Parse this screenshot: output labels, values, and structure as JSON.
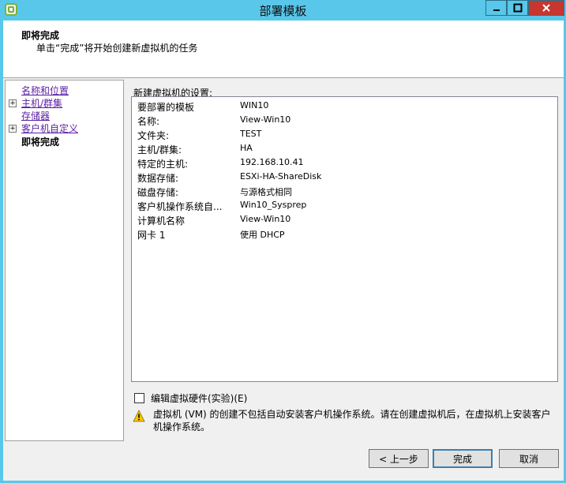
{
  "window": {
    "title": "部署模板"
  },
  "header": {
    "title": "即将完成",
    "subtitle": "单击“完成”将开始创建新虚拟机的任务"
  },
  "nav": [
    {
      "label": "名称和位置",
      "link": true,
      "expandable": false
    },
    {
      "label": "主机/群集",
      "link": true,
      "expandable": true
    },
    {
      "label": "存储器",
      "link": true,
      "expandable": false
    },
    {
      "label": "客户机自定义",
      "link": true,
      "expandable": true
    },
    {
      "label": "即将完成",
      "link": false,
      "expandable": false
    }
  ],
  "settings": {
    "label": "新建虚拟机的设置:",
    "rows": [
      {
        "key": "要部署的模板",
        "value": "WIN10"
      },
      {
        "key": "名称:",
        "value": "View-Win10"
      },
      {
        "key": "文件夹:",
        "value": "TEST"
      },
      {
        "key": "主机/群集:",
        "value": "HA"
      },
      {
        "key": "特定的主机:",
        "value": "192.168.10.41"
      },
      {
        "key": "数据存储:",
        "value": "ESXi-HA-ShareDisk"
      },
      {
        "key": "磁盘存储:",
        "value": "与源格式相同"
      },
      {
        "key": "客户机操作系统自...",
        "value": "Win10_Sysprep"
      },
      {
        "key": "计算机名称",
        "value": "View-Win10"
      },
      {
        "key": "网卡 1",
        "value": "使用 DHCP"
      }
    ]
  },
  "edit_hardware": {
    "label": "编辑虚拟硬件(实验)(E)",
    "checked": false
  },
  "warning": {
    "text": "虚拟机 (VM) 的创建不包括自动安装客户机操作系统。请在创建虚拟机后，在虚拟机上安装客户机操作系统。"
  },
  "buttons": {
    "back": "< 上一步",
    "finish": "完成",
    "cancel": "取消"
  },
  "colors": {
    "titlebar": "#58c7ea",
    "close": "#c7362f",
    "link": "#5b1fa4"
  }
}
